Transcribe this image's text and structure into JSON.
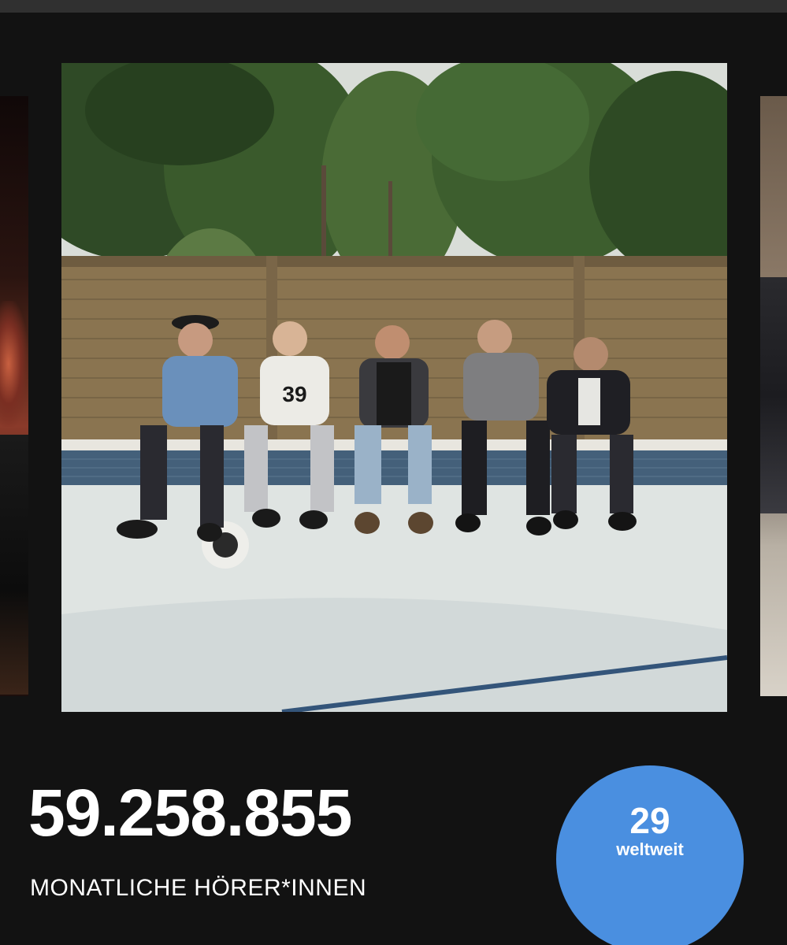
{
  "artist": {
    "image_alt": "Five band members sitting on the edge of an empty swimming pool in front of a brick wall",
    "monthly_listeners": "59.258.855",
    "monthly_listeners_label": "MONATLICHE HÖRER*INNEN"
  },
  "rank": {
    "position": "29",
    "label": "weltweit",
    "color": "#4a8fe0"
  },
  "colors": {
    "background": "#121212",
    "text": "#ffffff"
  }
}
